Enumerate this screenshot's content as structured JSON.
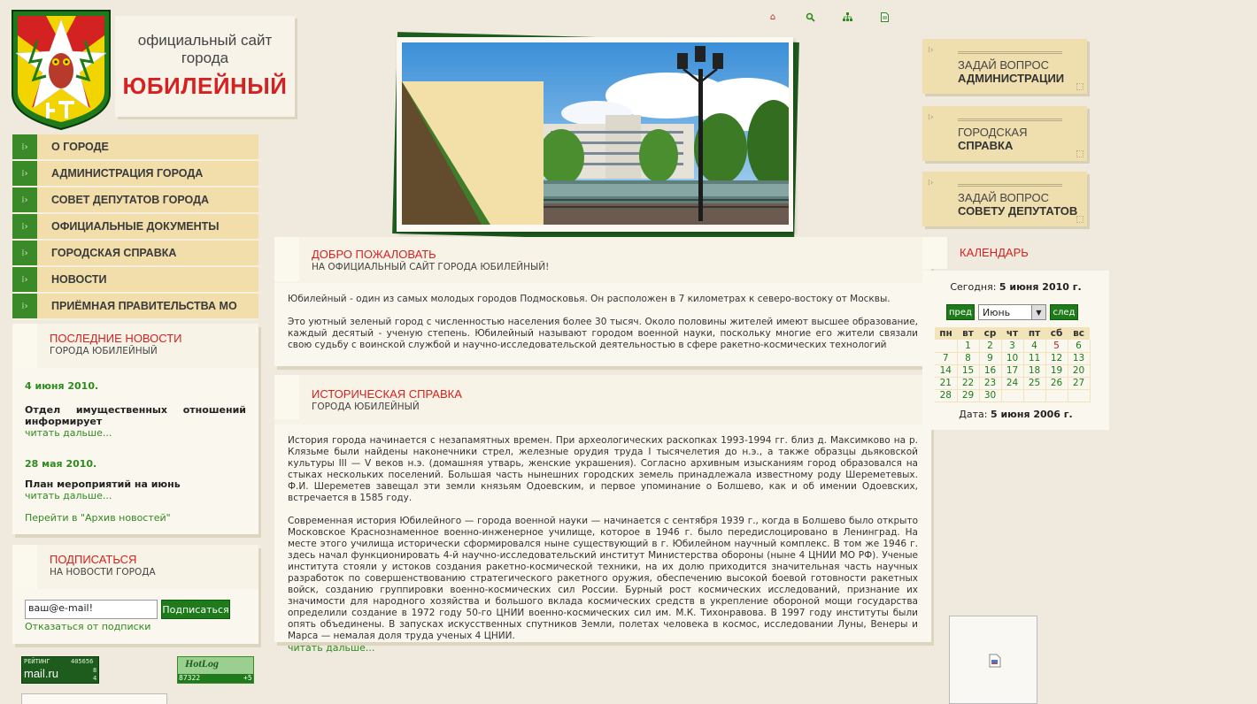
{
  "header": {
    "logo_line1": "официальный сайт",
    "logo_line2": "города",
    "logo_city": "ЮБИЛЕЙНЫЙ",
    "top_icons": [
      "home-icon",
      "search-icon",
      "sitemap-icon",
      "document-icon"
    ]
  },
  "menu": {
    "items": [
      {
        "label": "О ГОРОДЕ"
      },
      {
        "label": "АДМИНИСТРАЦИЯ ГОРОДА"
      },
      {
        "label": "СОВЕТ ДЕПУТАТОВ ГОРОДА"
      },
      {
        "label": "ОФИЦИАЛЬНЫЕ ДОКУМЕНТЫ"
      },
      {
        "label": "ГОРОДСКАЯ СПРАВКА"
      },
      {
        "label": "НОВОСТИ"
      },
      {
        "label": "ПРИЁМНАЯ ПРАВИТЕЛЬСТВА МО"
      }
    ]
  },
  "news": {
    "title": "ПОСЛЕДНИЕ НОВОСТИ",
    "subtitle": "ГОРОДА ЮБИЛЕЙНЫЙ",
    "items": [
      {
        "date": "4 июня 2010.",
        "title": "Отдел имущественных отношений информирует",
        "more": "читать дальше..."
      },
      {
        "date": "28 мая 2010.",
        "title": "План мероприятий на июнь",
        "more": "читать дальше..."
      }
    ],
    "archive_link": "Перейти в \"Архив новостей\""
  },
  "subscribe": {
    "title": "ПОДПИСАТЬСЯ",
    "subtitle": "НА НОВОСТИ ГОРОДА",
    "email_value": "ваш@e-mail!",
    "button": "Подписаться",
    "unsubscribe": "Отказаться от подписки"
  },
  "counters": {
    "rating_label": "РЕЙТИНГ",
    "rating_value": "405656",
    "rating_brand": "mail.ru",
    "rating_small1": "8",
    "rating_small2": "4",
    "hotlog_brand": "HotLog",
    "hotlog_value": "87322",
    "hotlog_delta": "+5"
  },
  "welcome": {
    "title": "ДОБРО ПОЖАЛОВАТЬ",
    "subtitle": "НА ОФИЦИАЛЬНЫЙ САЙТ ГОРОДА ЮБИЛЕЙНЫЙ!",
    "p1": "Юбилейный - один из самых молодых городов Подмосковья. Он расположен в 7 километрах к северо-востоку от Москвы.",
    "p2": "Это уютный зеленый город с численностью населения более 30 тысяч. Около половины жителей имеют высшее образование, каждый десятый - ученую степень. Юбилейный называют городом военной науки, поскольку многие его жители связали свою судьбу с воинской службой и научно-исследовательской деятельностью в сфере ракетно-космических технологий"
  },
  "history": {
    "title": "ИСТОРИЧЕСКАЯ СПРАВКА",
    "subtitle": "ГОРОДА ЮБИЛЕЙНЫЙ",
    "p1": "История города начинается с незапамятных времен. При археологических раскопках 1993-1994 гг. близ д. Максимково на р. Клязьме были найдены наконечники стрел, железные орудия труда I тысячелетия до н.э., а также образцы дьяковской культуры III — V веков н.э. (домашняя утварь, женские украшения). Согласно архивным изысканиям город образовался на стыках нескольких поселений. Большая часть нынешних городских земель принадлежала известному роду Шереметевых. Ф.И. Шереметев завещал эти земли князьям Одоевским, и первое упоминание о Болшево, как и об имении Одоевских, встречается в 1585 году.",
    "p2": "Современная история Юбилейного — города военной науки — начинается с сентября 1939 г., когда в Болшево было открыто Московское Краснознаменное военно-инженерное училище, которое в 1946 г. было передислоцировано в Ленинград. На месте этого училища исторически сформировался ныне существующий в г. Юбилейном научный комплекс. В том же 1946 г. здесь начал функционировать 4-й научно-исследовательский институт Министерства обороны (ныне 4 ЦНИИ МО РФ). Ученые института стояли у истоков создания ракетно-космической техники, на их долю приходится значительная часть научных разработок по совершенствованию стратегического ракетного оружия, обеспечению высокой боевой готовности ракетных войск, созданию группировки военно-космических сил России. Бурный рост космических исследований, признание их значимости для народного хозяйства и большого вклада космических средств в укрепление обороной мощи государства определили создание в 1972 году 50-го ЦНИИ военно-космических сил им. М.К. Тихонравова. В 1997 году институты были опять объединены. В запусках искусственных спутников Земли, полетах человека в космос, исследовании Луны, Венеры и Марса — немалая доля труда ученых 4 ЦНИИ.",
    "more": "читать дальше..."
  },
  "right_buttons": [
    {
      "line1": "ЗАДАЙ ВОПРОС",
      "line2": "АДМИНИСТРАЦИИ"
    },
    {
      "line1": "ГОРОДСКАЯ",
      "line2": "СПРАВКА"
    },
    {
      "line1": "ЗАДАЙ ВОПРОС",
      "line2": "СОВЕТУ ДЕПУТАТОВ"
    }
  ],
  "calendar": {
    "title": "КАЛЕНДАРЬ",
    "today_label": "Сегодня:",
    "today_value": "5 июня 2010 г.",
    "prev": "пред",
    "next": "след",
    "month": "Июнь",
    "weekdays": [
      "пн",
      "вт",
      "ср",
      "чт",
      "пт",
      "сб",
      "вс"
    ],
    "weeks": [
      [
        "",
        "1",
        "2",
        "3",
        "4",
        "5",
        "6"
      ],
      [
        "7",
        "8",
        "9",
        "10",
        "11",
        "12",
        "13"
      ],
      [
        "14",
        "15",
        "16",
        "17",
        "18",
        "19",
        "20"
      ],
      [
        "21",
        "22",
        "23",
        "24",
        "25",
        "26",
        "27"
      ],
      [
        "28",
        "29",
        "30",
        "",
        "",
        "",
        ""
      ]
    ],
    "date_label": "Дата:",
    "date_value": "5 июня 2006 г."
  }
}
